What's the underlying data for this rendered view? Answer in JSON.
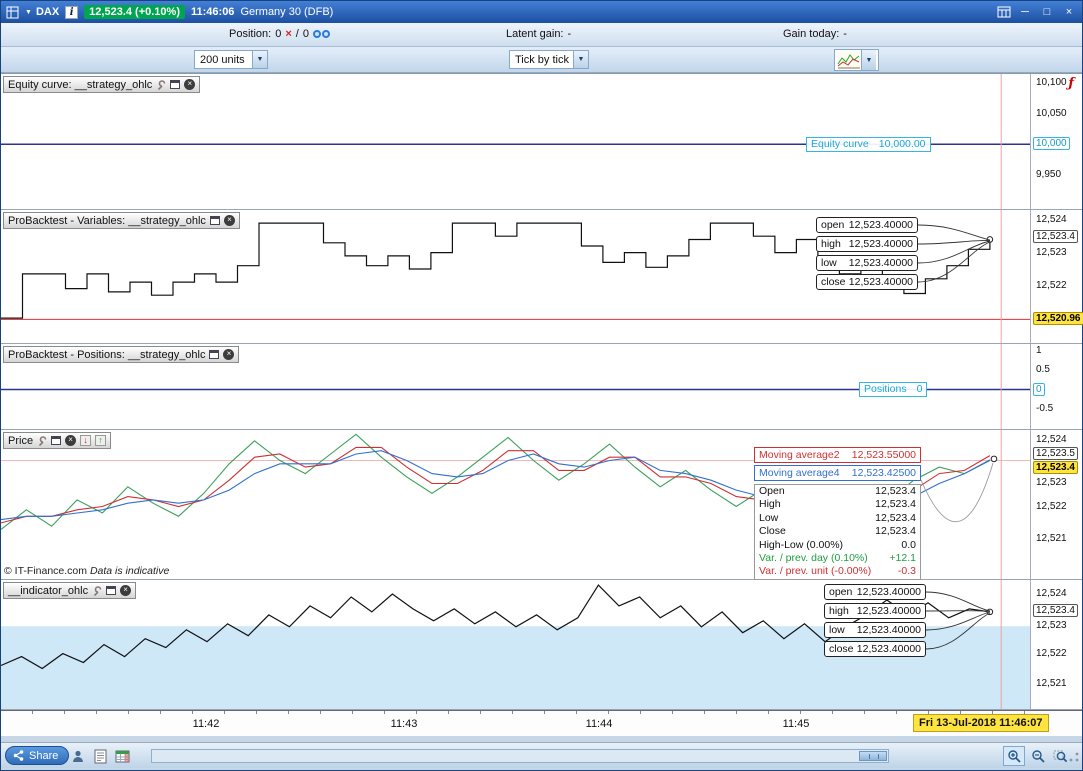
{
  "icons": {
    "caret_down": "▼",
    "close_x": "×",
    "red_x": "×",
    "arrow_up": "↑",
    "arrow_down": "↓",
    "fn": "ƒ",
    "minimize": "─",
    "maximize": "□",
    "window_close": "×",
    "info": "i"
  },
  "colors": {
    "titlebar_blue": "#1e55a8",
    "price_badge_green": "#00a550",
    "accent_cyan": "#2ab0dc",
    "highlight_yellow": "#ffe33e",
    "ma_red": "#d03030",
    "ma_blue": "#3070d0",
    "price_green": "#3aa05a",
    "cursor_red": "#eda0a0"
  },
  "titlebar": {
    "symbol": "DAX",
    "price_badge": "12,523.4 (+0.10%)",
    "clock": "11:46:06",
    "instrument": "Germany 30 (DFB)"
  },
  "toolbar": {
    "position_label": "Position:",
    "position_value": "0",
    "separator": "/",
    "orders_value": "0",
    "latent_gain_label": "Latent gain:",
    "latent_gain_value": "-",
    "gain_today_label": "Gain today:",
    "gain_today_value": "-"
  },
  "controls": {
    "units_select": "200 units",
    "timeframe_select": "Tick by tick"
  },
  "panels": {
    "equity": {
      "title": "Equity curve: __strategy_ohlc",
      "curve_label": "Equity curve",
      "curve_value": "10,000.00",
      "axis": {
        "t1": "10,100",
        "t2": "10,050",
        "badge": "10,000",
        "t3": "9,950"
      }
    },
    "variables": {
      "title": "ProBacktest - Variables: __strategy_ohlc",
      "ohlc": [
        {
          "label": "open",
          "value": "12,523.40000"
        },
        {
          "label": "high",
          "value": "12,523.40000"
        },
        {
          "label": "low",
          "value": "12,523.40000"
        },
        {
          "label": "close",
          "value": "12,523.40000"
        }
      ],
      "axis": {
        "t1": "12,524",
        "badge1": "12,523.4",
        "t2": "12,523",
        "t3": "12,522",
        "last_badge": "12,520.96"
      }
    },
    "positions": {
      "title": "ProBacktest - Positions: __strategy_ohlc",
      "line_label": "Positions",
      "line_value": "0",
      "axis": {
        "t1": "1",
        "t2": "0.5",
        "badge": "0",
        "t3": "-0.5"
      }
    },
    "price": {
      "title": "Price",
      "ma2_label": "Moving average2",
      "ma2_value": "12,523.55000",
      "ma4_label": "Moving average4",
      "ma4_value": "12,523.42500",
      "info_rows": [
        {
          "label": "Open",
          "value": "12,523.4"
        },
        {
          "label": "High",
          "value": "12,523.4"
        },
        {
          "label": "Low",
          "value": "12,523.4"
        },
        {
          "label": "Close",
          "value": "12,523.4"
        },
        {
          "label": "High-Low (0.00%)",
          "value": "0.0"
        },
        {
          "label": "Var. / prev. day (0.10%)",
          "value": "+12.1"
        },
        {
          "label": "Var. / prev. unit (-0.00%)",
          "value": "-0.3"
        }
      ],
      "copyright": "© IT-Finance.com",
      "copyright_note": "Data is indicative",
      "axis": {
        "t1": "12,524",
        "badge1": "12,523.5",
        "badge_last": "12,523.4",
        "t2": "12,523",
        "t3": "12,522",
        "t4": "12,521"
      }
    },
    "indicator": {
      "title": "__indicator_ohlc",
      "ohlc": [
        {
          "label": "open",
          "value": "12,523.40000"
        },
        {
          "label": "high",
          "value": "12,523.40000"
        },
        {
          "label": "low",
          "value": "12,523.40000"
        },
        {
          "label": "close",
          "value": "12,523.40000"
        }
      ],
      "axis": {
        "t1": "12,524",
        "badge1": "12,523.4",
        "t2": "12,523",
        "t3": "12,522",
        "t4": "12,521"
      }
    }
  },
  "xaxis": {
    "t1": "11:42",
    "t2": "11:43",
    "t3": "11:44",
    "t4": "11:45",
    "date_badge": "Fri 13-Jul-2018 11:46:07"
  },
  "footer": {
    "share_label": "Share"
  },
  "chart_data": {
    "xticks": [
      "11:42",
      "11:43",
      "11:44",
      "11:45"
    ],
    "cursor_time": "Fri 13-Jul-2018 11:46:07",
    "equity": {
      "type": "line",
      "title": "Equity curve",
      "y_domain": [
        9893,
        10116
      ],
      "yticks": [
        10100,
        10050,
        10000,
        9950
      ],
      "series": [
        {
          "name": "Equity curve",
          "color": "#2e3192",
          "width": 1.5,
          "x_end": 1,
          "values": [
            10000,
            10000
          ]
        }
      ],
      "vlines": [
        {
          "x": 0.972,
          "color": "#eda0a0"
        }
      ]
    },
    "variables": {
      "type": "line",
      "title": "ProBacktest - Variables",
      "y_domain": [
        12520.24,
        12524.3
      ],
      "yticks": [
        12524,
        12523,
        12522
      ],
      "open": 12523.4,
      "high": 12523.4,
      "low": 12523.4,
      "close": 12523.4,
      "last": 12520.96,
      "hlines": [
        {
          "y": 12520.96,
          "color": "#e03030",
          "width": 1
        }
      ],
      "series": [
        {
          "name": "variable",
          "color": "#111111",
          "width": 1.2,
          "step": true,
          "x_end": 0.961,
          "values": [
            12521.0,
            12522.35,
            12522.35,
            12521.9,
            12522.35,
            12521.8,
            12522.1,
            12521.7,
            12522.1,
            12522.35,
            12522.1,
            12522.6,
            12523.9,
            12523.9,
            12523.9,
            12523.3,
            12522.9,
            12522.6,
            12522.9,
            12522.5,
            12523.0,
            12523.9,
            12523.9,
            12523.5,
            12523.9,
            12523.9,
            12523.9,
            12523.2,
            12522.7,
            12523.0,
            12522.55,
            12522.9,
            12523.4,
            12523.9,
            12523.9,
            12523.5,
            12523.0,
            12523.4,
            12522.9,
            12522.35,
            12522.55,
            12522.1,
            12521.75,
            12522.2,
            12522.6,
            12523.1,
            12523.4
          ]
        }
      ],
      "vlines": [
        {
          "x": 0.972,
          "color": "#eda0a0"
        }
      ],
      "markers": [
        {
          "x": 0.961,
          "y": 12523.4
        }
      ]
    },
    "positions": {
      "type": "line",
      "title": "ProBacktest - Positions",
      "y_domain": [
        -1.0,
        1.15
      ],
      "yticks": [
        1,
        0.5,
        0,
        -0.5
      ],
      "series": [
        {
          "name": "Positions",
          "color": "#2e3192",
          "width": 1.5,
          "x_end": 1,
          "values": [
            0,
            0
          ]
        }
      ],
      "vlines": [
        {
          "x": 0.972,
          "color": "#eda0a0"
        }
      ]
    },
    "price": {
      "type": "line",
      "title": "Price",
      "y_domain": [
        12519.79,
        12524.33
      ],
      "yticks": [
        12524,
        12523,
        12522,
        12521
      ],
      "open": 12523.4,
      "high": 12523.4,
      "low": 12523.4,
      "close": 12523.4,
      "high_low": 0.0,
      "var_prev_day": 12.1,
      "var_prev_unit": -0.3,
      "ma2": 12523.55,
      "ma4": 12523.425,
      "hlines": [
        {
          "y": 12523.4,
          "color": "#f0b8b8",
          "width": 1
        }
      ],
      "series": [
        {
          "name": "Price",
          "color": "#3aa05a",
          "width": 1.1,
          "x_end": 0.961,
          "values": [
            12521.3,
            12521.9,
            12521.4,
            12522.2,
            12521.8,
            12522.6,
            12522.1,
            12521.7,
            12522.4,
            12523.3,
            12524.0,
            12523.4,
            12523.0,
            12523.6,
            12524.2,
            12523.5,
            12522.9,
            12522.4,
            12522.9,
            12523.5,
            12524.1,
            12523.4,
            12522.8,
            12523.3,
            12523.9,
            12523.2,
            12522.6,
            12523.1,
            12522.5,
            12522.0,
            12522.5,
            12521.8,
            12521.3,
            12521.9,
            12521.5,
            12522.2,
            12522.8,
            12523.2,
            12523.0,
            12523.4
          ]
        },
        {
          "name": "Moving average2",
          "color": "#d03030",
          "width": 1.1,
          "x_end": 0.961,
          "values": [
            12521.5,
            12521.7,
            12521.7,
            12521.9,
            12522.0,
            12522.3,
            12522.2,
            12522.0,
            12522.2,
            12522.8,
            12523.5,
            12523.6,
            12523.2,
            12523.3,
            12523.8,
            12523.8,
            12523.2,
            12522.7,
            12522.7,
            12523.1,
            12523.7,
            12523.7,
            12523.1,
            12523.1,
            12523.5,
            12523.5,
            12522.9,
            12522.9,
            12522.7,
            12522.3,
            12522.2,
            12522.1,
            12521.6,
            12521.6,
            12521.6,
            12521.9,
            12522.5,
            12523.0,
            12523.1,
            12523.55
          ]
        },
        {
          "name": "Moving average4",
          "color": "#3070d0",
          "width": 1.1,
          "x_end": 0.961,
          "values": [
            12521.6,
            12521.7,
            12521.7,
            12521.8,
            12521.9,
            12522.1,
            12522.2,
            12522.1,
            12522.2,
            12522.5,
            12523.0,
            12523.3,
            12523.3,
            12523.3,
            12523.6,
            12523.7,
            12523.4,
            12523.0,
            12522.9,
            12523.0,
            12523.4,
            12523.6,
            12523.3,
            12523.2,
            12523.4,
            12523.5,
            12523.1,
            12523.0,
            12522.8,
            12522.5,
            12522.3,
            12522.2,
            12521.9,
            12521.7,
            12521.7,
            12521.9,
            12522.3,
            12522.7,
            12523.0,
            12523.42
          ]
        }
      ],
      "vlines": [
        {
          "x": 0.972,
          "color": "#eda0a0"
        }
      ],
      "markers": [
        {
          "x": 0.965,
          "y": 12523.45
        }
      ]
    },
    "indicator": {
      "type": "line",
      "title": "__indicator_ohlc",
      "y_domain": [
        12520.14,
        12524.47
      ],
      "yticks": [
        12524,
        12523,
        12522,
        12521
      ],
      "open": 12523.4,
      "high": 12523.4,
      "low": 12523.4,
      "close": 12523.4,
      "bands": [
        {
          "top": 12522.92,
          "bottom": 12520.14,
          "color": "#cfe8f8"
        }
      ],
      "series": [
        {
          "name": "indicator",
          "color": "#111111",
          "width": 1.2,
          "x_end": 0.961,
          "values": [
            12521.6,
            12521.9,
            12521.5,
            12522.0,
            12521.7,
            12522.3,
            12521.9,
            12522.5,
            12522.2,
            12522.8,
            12522.4,
            12523.0,
            12522.6,
            12523.3,
            12522.9,
            12523.6,
            12523.2,
            12523.9,
            12523.4,
            12524.0,
            12523.5,
            12523.1,
            12523.5,
            12523.0,
            12523.4,
            12522.9,
            12523.3,
            12522.8,
            12523.2,
            12524.3,
            12523.6,
            12523.9,
            12523.2,
            12523.6,
            12522.9,
            12523.4,
            12522.7,
            12523.1,
            12522.5,
            12523.0,
            12522.4,
            12522.9,
            12523.3,
            12523.8,
            12523.3,
            12523.7,
            12523.2,
            12523.5,
            12523.4
          ]
        }
      ],
      "vlines": [
        {
          "x": 0.972,
          "color": "#eda0a0"
        }
      ],
      "markers": [
        {
          "x": 0.961,
          "y": 12523.4
        }
      ]
    }
  }
}
